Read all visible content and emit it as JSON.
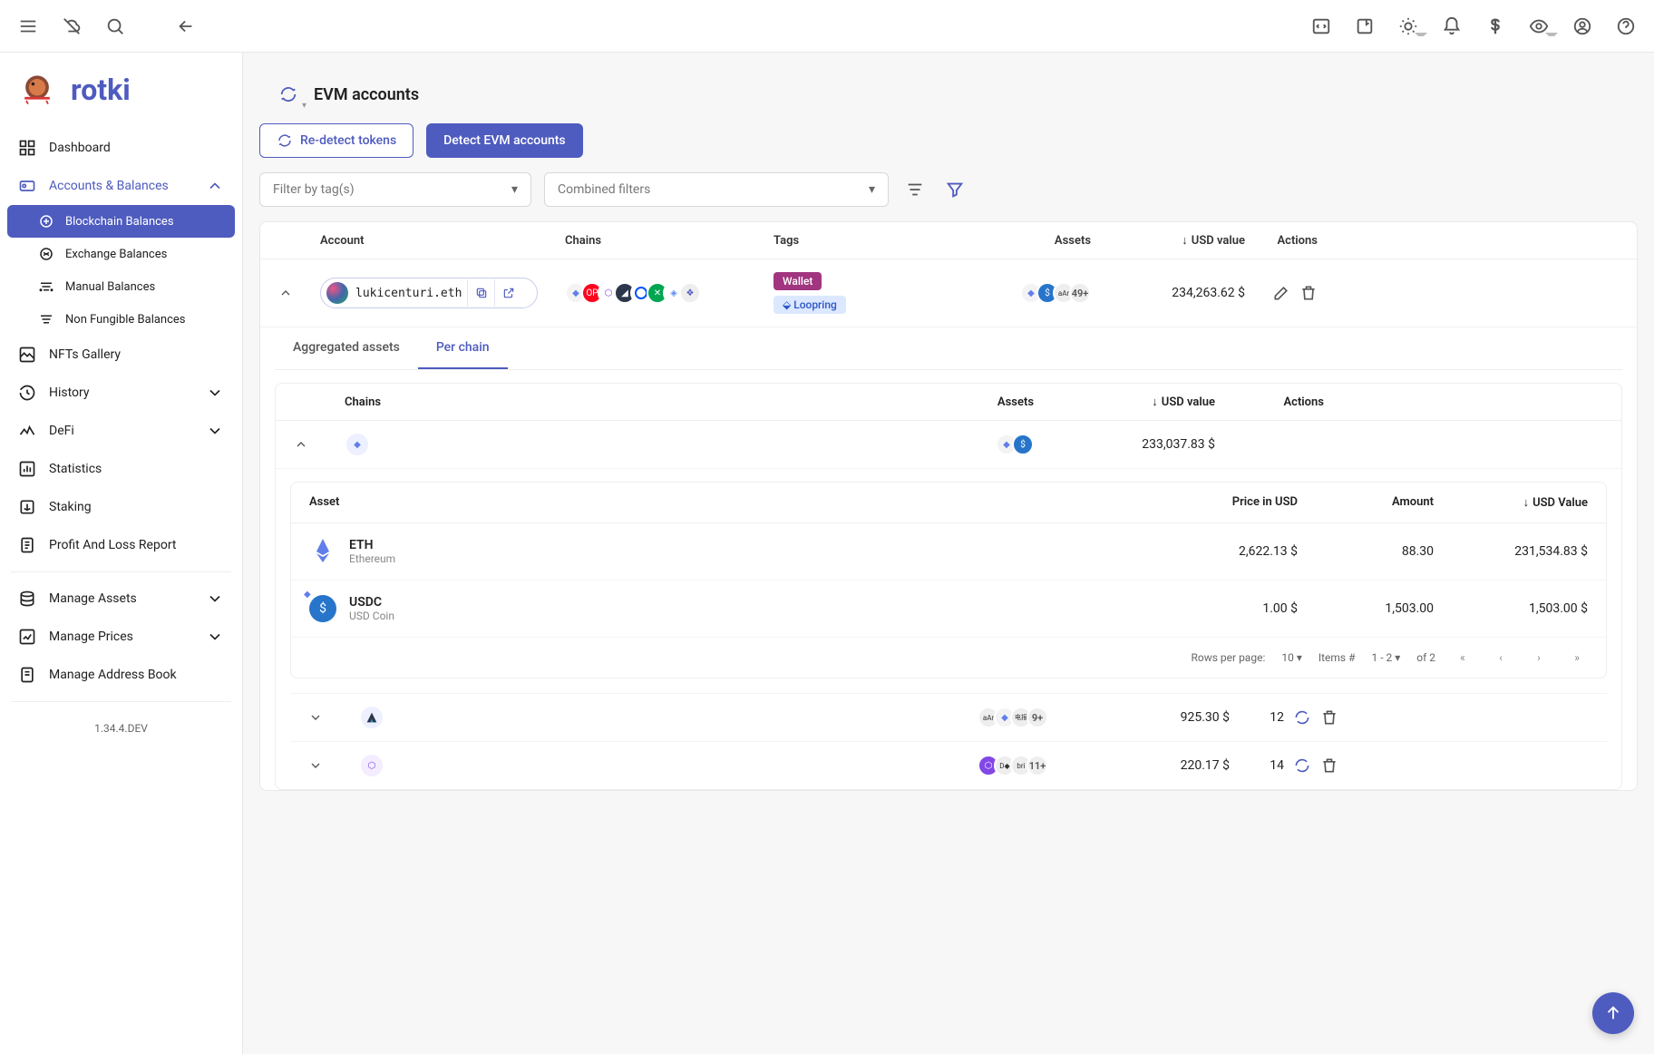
{
  "brand": "rotki",
  "version": "1.34.4.DEV",
  "page": {
    "title": "EVM accounts"
  },
  "buttons": {
    "redetect": "Re-detect tokens",
    "detect": "Detect EVM accounts"
  },
  "filters": {
    "tags_placeholder": "Filter by tag(s)",
    "combined_placeholder": "Combined filters"
  },
  "nav": {
    "dashboard": "Dashboard",
    "accounts": "Accounts & Balances",
    "blockchain": "Blockchain Balances",
    "exchange": "Exchange Balances",
    "manual": "Manual Balances",
    "nft_bal": "Non Fungible Balances",
    "nfts": "NFTs Gallery",
    "history": "History",
    "defi": "DeFi",
    "stats": "Statistics",
    "staking": "Staking",
    "pnl": "Profit And Loss Report",
    "manage_assets": "Manage Assets",
    "manage_prices": "Manage Prices",
    "address_book": "Manage Address Book"
  },
  "columns": {
    "account": "Account",
    "chains": "Chains",
    "tags": "Tags",
    "assets": "Assets",
    "usd": "USD value",
    "actions": "Actions",
    "asset": "Asset",
    "price": "Price in USD",
    "amount": "Amount",
    "usd_value": "USD Value"
  },
  "tabs": {
    "aggregated": "Aggregated assets",
    "per_chain": "Per chain"
  },
  "main_row": {
    "address": "lukicenturi.eth",
    "asset_more": "49+",
    "usd": "234,263.62 $",
    "tag_wallet": {
      "label": "Wallet",
      "bg": "#a1357f",
      "fg": "#ffffff"
    },
    "tag_loopring": {
      "label": "Loopring",
      "bg": "#dbe8ff",
      "fg": "#2d55c5"
    }
  },
  "chain_row": {
    "usd": "233,037.83 $"
  },
  "assets": [
    {
      "symbol": "ETH",
      "name": "Ethereum",
      "price": "2,622.13 $",
      "amount": "88.30",
      "value": "231,534.83 $"
    },
    {
      "symbol": "USDC",
      "name": "USD Coin",
      "price": "1.00 $",
      "amount": "1,503.00",
      "value": "1,503.00 $"
    }
  ],
  "pager": {
    "label": "Rows per page:",
    "per": "10",
    "items_label": "Items #",
    "range": "1 - 2",
    "of": "of 2"
  },
  "sub_rows": [
    {
      "more": "9+",
      "usd": "925.30 $",
      "count": "12"
    },
    {
      "more": "11+",
      "usd": "220.17 $",
      "count": "14"
    }
  ]
}
